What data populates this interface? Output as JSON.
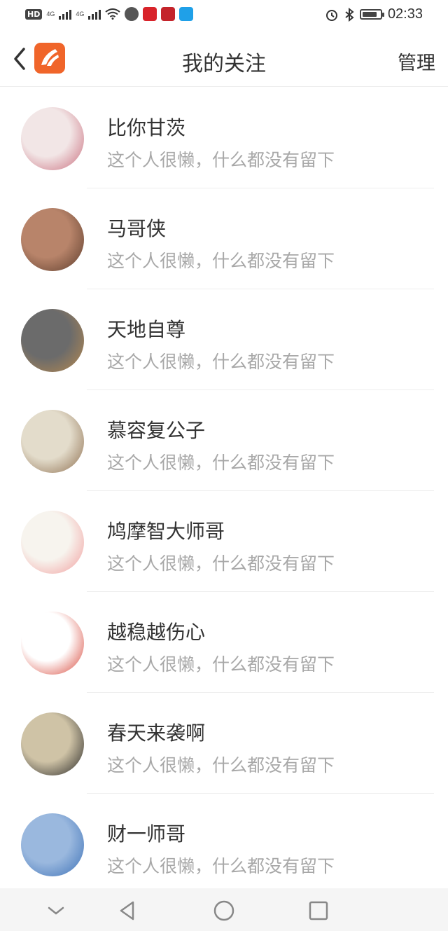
{
  "status_bar": {
    "network_tag": "HD",
    "network_label_1": "4G",
    "network_label_2": "4G",
    "time": "02:33",
    "battery_level_percent": 85
  },
  "header": {
    "title": "我的关注",
    "manage_label": "管理"
  },
  "follows": [
    {
      "name": "比你甘茨",
      "signature": "这个人很懒，什么都没有留下",
      "avatar_colors": [
        "#f2e6e6",
        "#c86a7a"
      ]
    },
    {
      "name": "马哥侠",
      "signature": "这个人很懒，什么都没有留下",
      "avatar_colors": [
        "#b8846a",
        "#5a3a2a"
      ]
    },
    {
      "name": "天地自尊",
      "signature": "这个人很懒，什么都没有留下",
      "avatar_colors": [
        "#6b6b6b",
        "#b98a4e"
      ]
    },
    {
      "name": "慕容复公子",
      "signature": "这个人很懒，什么都没有留下",
      "avatar_colors": [
        "#e3dccb",
        "#8a6a4a"
      ]
    },
    {
      "name": "鸠摩智大师哥",
      "signature": "这个人很懒，什么都没有留下",
      "avatar_colors": [
        "#f7f4ee",
        "#f19a9a"
      ]
    },
    {
      "name": "越稳越伤心",
      "signature": "这个人很懒，什么都没有留下",
      "avatar_colors": [
        "#ffffff",
        "#d64032"
      ]
    },
    {
      "name": "春天来袭啊",
      "signature": "这个人很懒，什么都没有留下",
      "avatar_colors": [
        "#cfc3a6",
        "#222222"
      ]
    },
    {
      "name": "财一师哥",
      "signature": "这个人很懒，什么都没有留下",
      "avatar_colors": [
        "#9ab8de",
        "#3a6fb6"
      ]
    }
  ],
  "nav_bar": {
    "icons": [
      "chevron-down-icon",
      "back-triangle-icon",
      "home-circle-icon",
      "recents-square-icon"
    ]
  }
}
